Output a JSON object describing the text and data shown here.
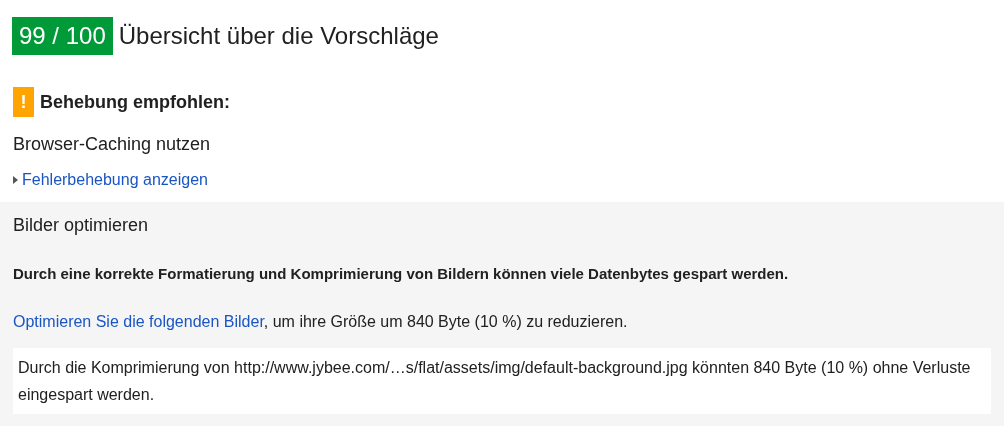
{
  "score": "99 / 100",
  "title": "Übersicht über die Vorschläge",
  "warning": {
    "icon": "!",
    "heading": "Behebung empfohlen:"
  },
  "rules": [
    {
      "title": "Browser-Caching nutzen",
      "expanded": false,
      "toggle": "Fehlerbehebung anzeigen"
    },
    {
      "title": "Bilder optimieren",
      "expanded": true,
      "summary": "Durch eine korrekte Formatierung und Komprimierung von Bildern können viele Datenbytes gespart werden.",
      "link": "Optimieren Sie die folgenden Bilder",
      "link_rest": ", um ihre Größe um 840 Byte (10 %) zu reduzieren.",
      "items": [
        "Durch die Komprimierung von http://www.jybee.com/…s/flat/assets/img/default-background.jpg könnten 840 Byte (10 %) ohne Verluste eingespart werden."
      ]
    }
  ]
}
